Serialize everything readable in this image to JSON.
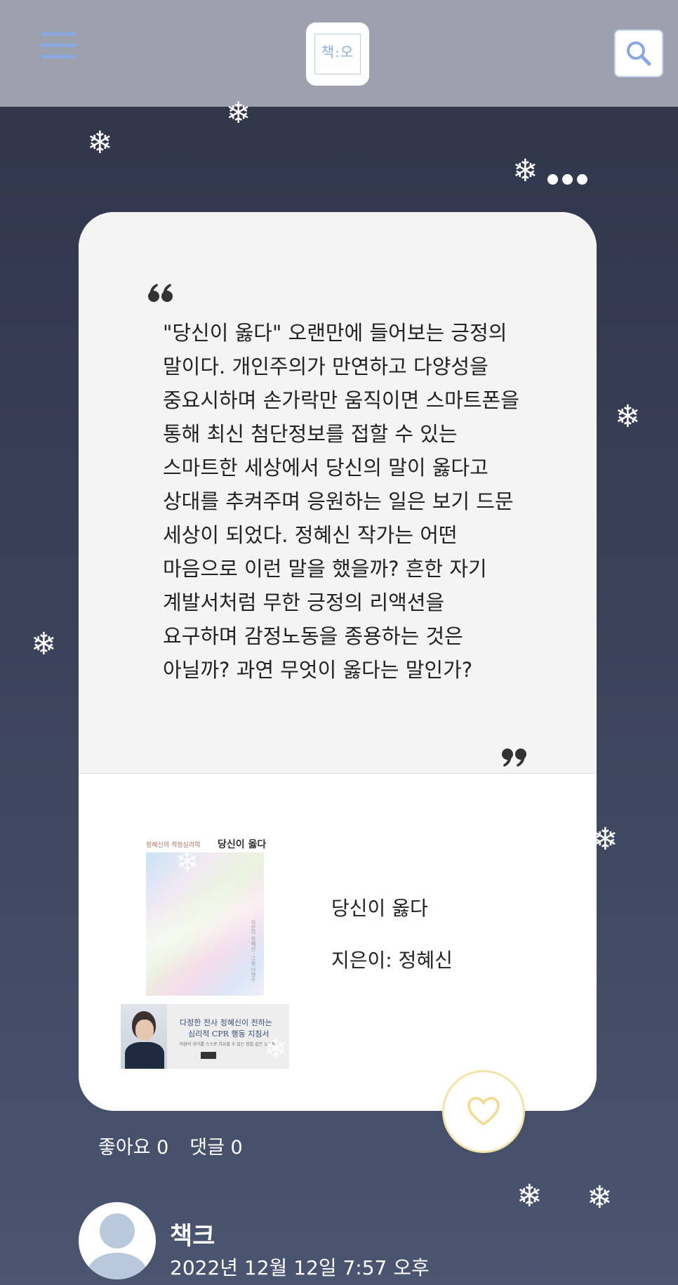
{
  "header": {
    "menu_icon": "hamburger-icon",
    "logo_text": "책:오",
    "search_icon": "search-icon"
  },
  "post": {
    "more_icon": "more-dots-icon",
    "quote_text": "\"당신이 옳다\" 오랜만에 들어보는 긍정의 말이다. 개인주의가 만연하고 다양성을 중요시하며 손가락만 움직이면 스마트폰을 통해 최신 첨단정보를 접할 수 있는 스마트한 세상에서 당신의 말이 옳다고 상대를 추켜주며 응원하는 일은 보기 드문 세상이 되었다. 정혜신 작가는 어떤 마음으로 이런 말을 했을까? 흔한 자기 계발서처럼 무한 긍정의 리액션을 요구하며 감정노동을 종용하는 것은 아닐까? 과연 무엇이 옳다는 말인가?",
    "book": {
      "cover_series": "정혜신의 적정심리학",
      "cover_title": "당신이 옳다",
      "cover_author": "지은이 정혜신 · 그림 이명수",
      "band_line1": "다정한 전사 정혜신이 전하는",
      "band_line2": "심리적 CPR 행동 지침서",
      "band_line3": "마음의 위기를 스스로 치유할 수 있는 집밥 같은 심리학",
      "title": "당신이 옳다",
      "author": "지은이: 정혜신"
    },
    "like_icon": "heart-icon",
    "likes_label": "좋아요 0",
    "comments_label": "댓글 0",
    "user": {
      "name": "책크",
      "timestamp": "2022년 12월 12일 7:57 오후"
    }
  },
  "colors": {
    "header_bg": "#9da1ad",
    "accent": "#8aa8de",
    "background_top": "#2f3448",
    "background_bottom": "#4a5570",
    "like_border": "#f4e3a8"
  }
}
